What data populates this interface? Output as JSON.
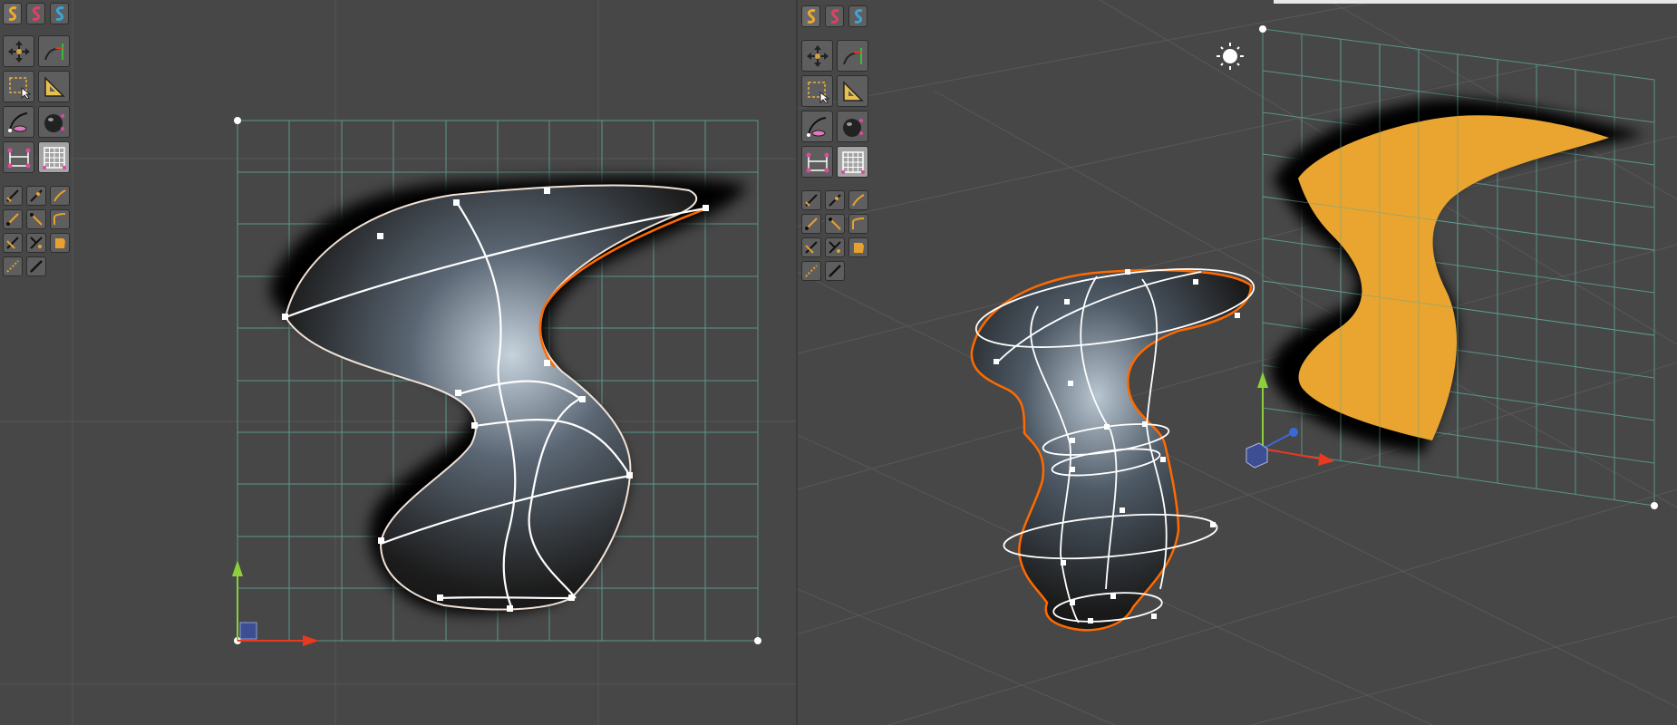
{
  "app": {
    "panes": [
      "front-view",
      "perspective-view"
    ]
  },
  "toolbar": {
    "category_buttons": [
      {
        "name": "category-surface-button",
        "icon": "surface-s-icon",
        "color": "#f0a830",
        "active": true
      },
      {
        "name": "category-sculpt-button",
        "icon": "sculpt-s-icon",
        "color": "#e0406a",
        "active": false
      },
      {
        "name": "category-mesh-button",
        "icon": "mesh-s-icon",
        "color": "#3aa6d8",
        "active": false
      }
    ],
    "large_buttons": [
      [
        "move-tool-icon",
        "draw-curve-icon"
      ],
      [
        "select-region-icon",
        "measure-icon"
      ],
      [
        "sculpt-brush-icon",
        "shade-sphere-icon"
      ],
      [
        "symmetry-icon",
        "grid-icon"
      ]
    ],
    "small_buttons": [
      [
        "brush-a-icon",
        "brush-b-icon",
        "brush-c-icon"
      ],
      [
        "brush-d-icon",
        "brush-e-icon",
        "brush-f-icon"
      ],
      [
        "brush-g-icon",
        "brush-h-icon",
        "fill-icon"
      ],
      [
        "brush-i-icon",
        "brush-j-icon"
      ]
    ]
  },
  "scene": {
    "accent_selection": "#ff6a00",
    "axis_x_color": "#e83a1e",
    "axis_y_color": "#8bd03a",
    "axis_z_color": "#3a6ad8",
    "shadow_fill_color": "#e9a530",
    "icons": [
      "sun-light-icon",
      "axis-gizmo-icon",
      "origin-cube-icon"
    ]
  }
}
